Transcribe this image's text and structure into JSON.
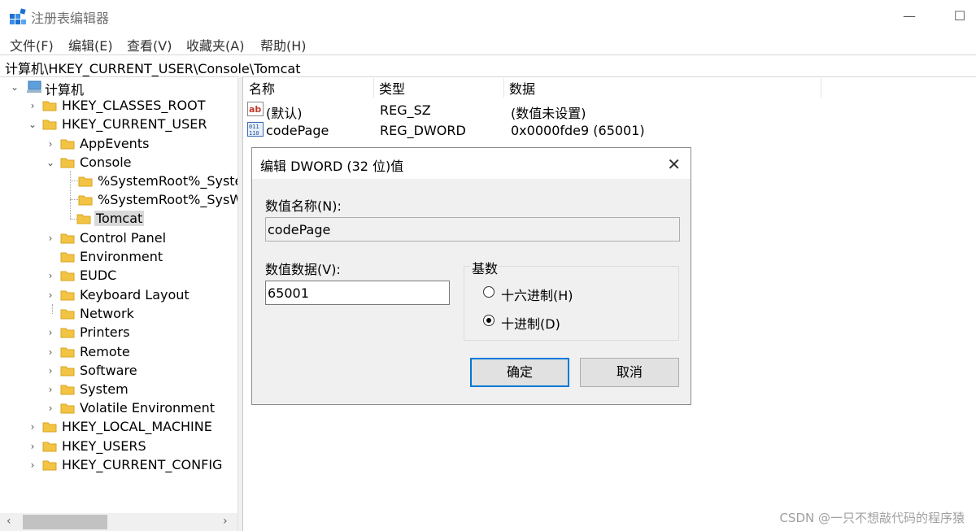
{
  "window": {
    "title": "注册表编辑器",
    "minimize_glyph": "—",
    "maximize_glyph": "☐"
  },
  "menu": [
    "文件(F)",
    "编辑(E)",
    "查看(V)",
    "收藏夹(A)",
    "帮助(H)"
  ],
  "address": "计算机\\HKEY_CURRENT_USER\\Console\\Tomcat",
  "tree": {
    "root": "计算机",
    "hkcr": "HKEY_CLASSES_ROOT",
    "hkcu": "HKEY_CURRENT_USER",
    "hkcu_children": {
      "appevents": "AppEvents",
      "console": "Console",
      "console_children": [
        "%SystemRoot%_Syster",
        "%SystemRoot%_SysW(",
        "Tomcat"
      ],
      "control_panel": "Control Panel",
      "environment": "Environment",
      "eudc": "EUDC",
      "keyboard_layout": "Keyboard Layout",
      "network": "Network",
      "printers": "Printers",
      "remote": "Remote",
      "software": "Software",
      "system": "System",
      "volatile": "Volatile Environment"
    },
    "hklm": "HKEY_LOCAL_MACHINE",
    "hku": "HKEY_USERS",
    "hkcc": "HKEY_CURRENT_CONFIG",
    "selected": "Tomcat"
  },
  "list": {
    "headers": [
      "名称",
      "类型",
      "数据"
    ],
    "rows": [
      {
        "name": "(默认)",
        "type": "REG_SZ",
        "data": "(数值未设置)",
        "icon": "string-value-icon"
      },
      {
        "name": "codePage",
        "type": "REG_DWORD",
        "data": "0x0000fde9 (65001)",
        "icon": "binary-value-icon"
      }
    ]
  },
  "dialog": {
    "title": "编辑 DWORD (32 位)值",
    "value_name_label": "数值名称(N):",
    "value_name": "codePage",
    "value_data_label": "数值数据(V):",
    "value_data": "65001",
    "base_label": "基数",
    "hex_label": "十六进制(H)",
    "dec_label": "十进制(D)",
    "selected_base": "十进制(D)",
    "ok_label": "确定",
    "cancel_label": "取消",
    "close_glyph": "✕"
  },
  "watermark": "CSDN @一只不想敲代码的程序猿",
  "colors": {
    "folder": "#f3c443",
    "accent": "#0078d7",
    "selection": "#d9d9d9"
  }
}
